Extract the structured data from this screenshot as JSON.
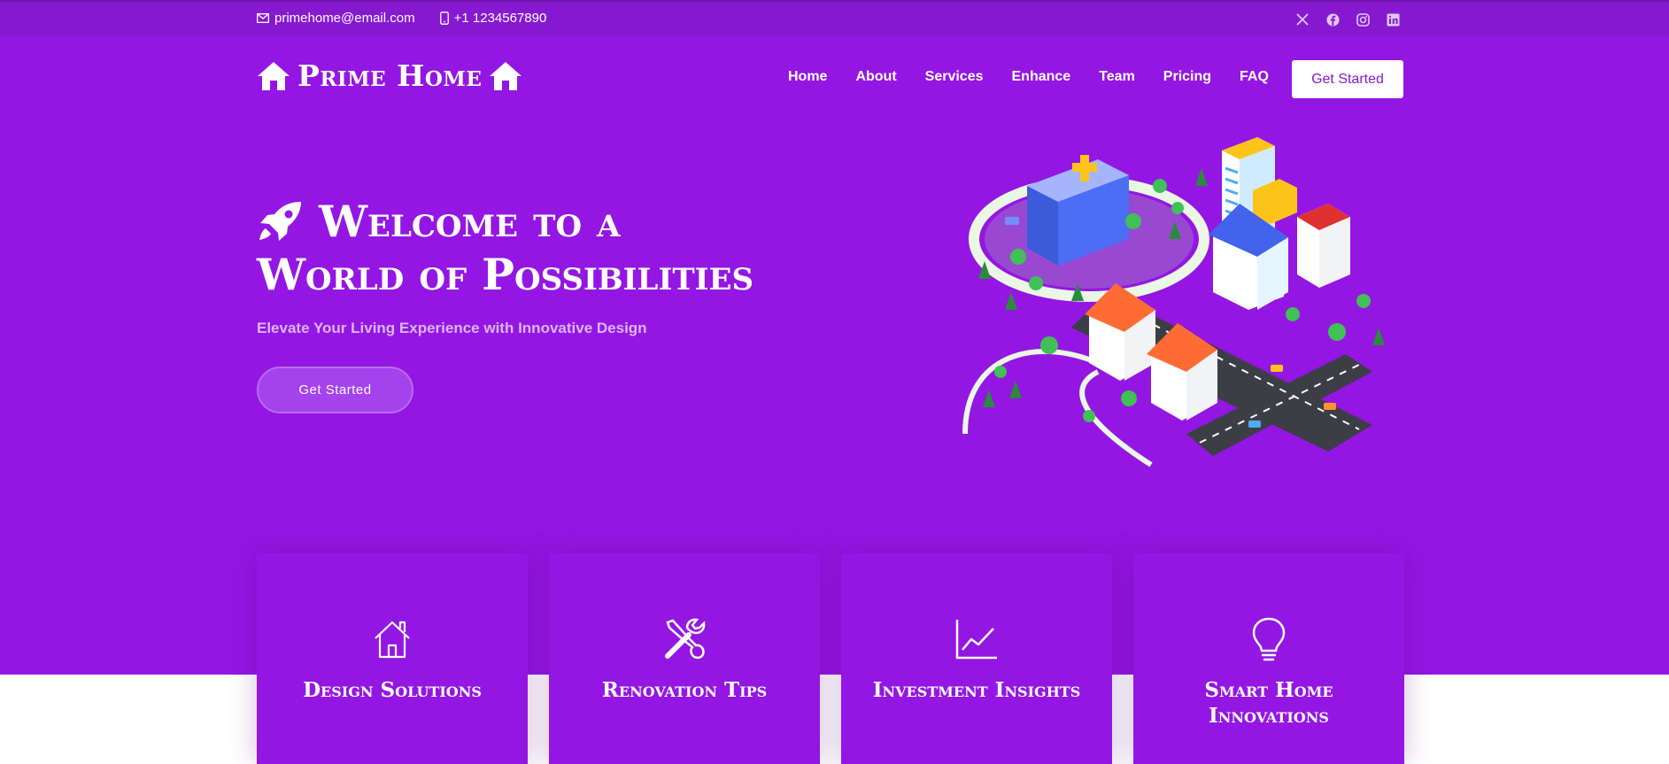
{
  "topbar": {
    "email": "primehome@email.com",
    "phone": "+1 1234567890",
    "social": [
      "x-icon",
      "facebook-icon",
      "instagram-icon",
      "linkedin-icon"
    ]
  },
  "brand": {
    "name": "Prime Home"
  },
  "nav": {
    "items": [
      "Home",
      "About",
      "Services",
      "Enhance",
      "Team",
      "Pricing",
      "FAQ"
    ],
    "cta": "Get Started"
  },
  "hero": {
    "title_line1": "Welcome to a",
    "title_line2": "World of Possibilities",
    "subtitle": "Elevate Your Living Experience with Innovative Design",
    "cta": "Get Started"
  },
  "cards": [
    {
      "icon": "house-icon",
      "title": "Design Solutions"
    },
    {
      "icon": "tools-icon",
      "title": "Renovation Tips"
    },
    {
      "icon": "chart-icon",
      "title": "Investment Insights"
    },
    {
      "icon": "lightbulb-icon",
      "title": "Smart Home Innovations"
    }
  ],
  "colors": {
    "brand": "#9416e2",
    "topbar": "#8619cf",
    "white": "#ffffff"
  }
}
